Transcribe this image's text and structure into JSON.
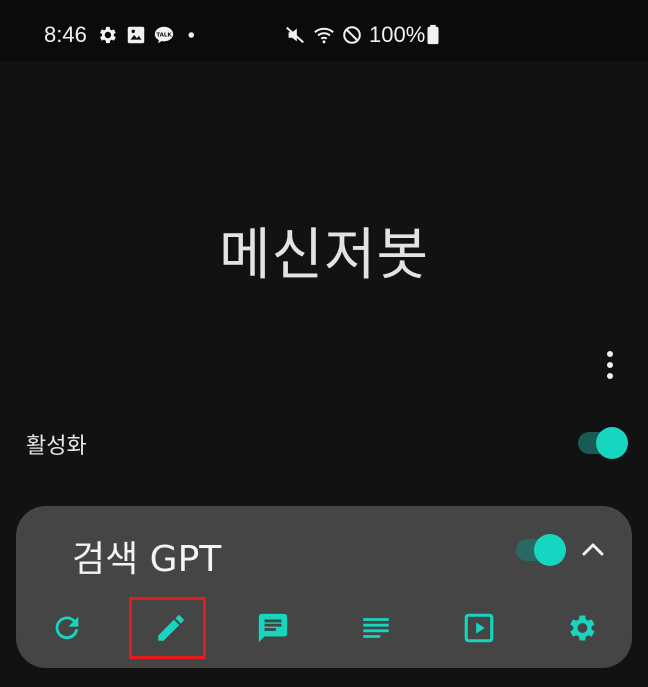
{
  "status_bar": {
    "time": "8:46",
    "battery": "100%",
    "icons": [
      "gear-icon",
      "image-icon",
      "talk-icon",
      "dot-icon",
      "mute-icon",
      "wifi-icon",
      "do-not-disturb-icon",
      "battery-icon"
    ],
    "talk_badge": "TALK"
  },
  "app": {
    "title": "메신저봇"
  },
  "settings": {
    "activate_label": "활성화",
    "activate_on": true
  },
  "bot_card": {
    "name": "검색 GPT",
    "enabled": true,
    "actions": [
      "refresh-icon",
      "pencil-icon",
      "chat-icon",
      "list-icon",
      "play-box-icon",
      "settings-icon"
    ]
  },
  "colors": {
    "accent": "#16d6c0",
    "background": "#121212",
    "card": "#454545",
    "highlight": "#e31b1b"
  }
}
